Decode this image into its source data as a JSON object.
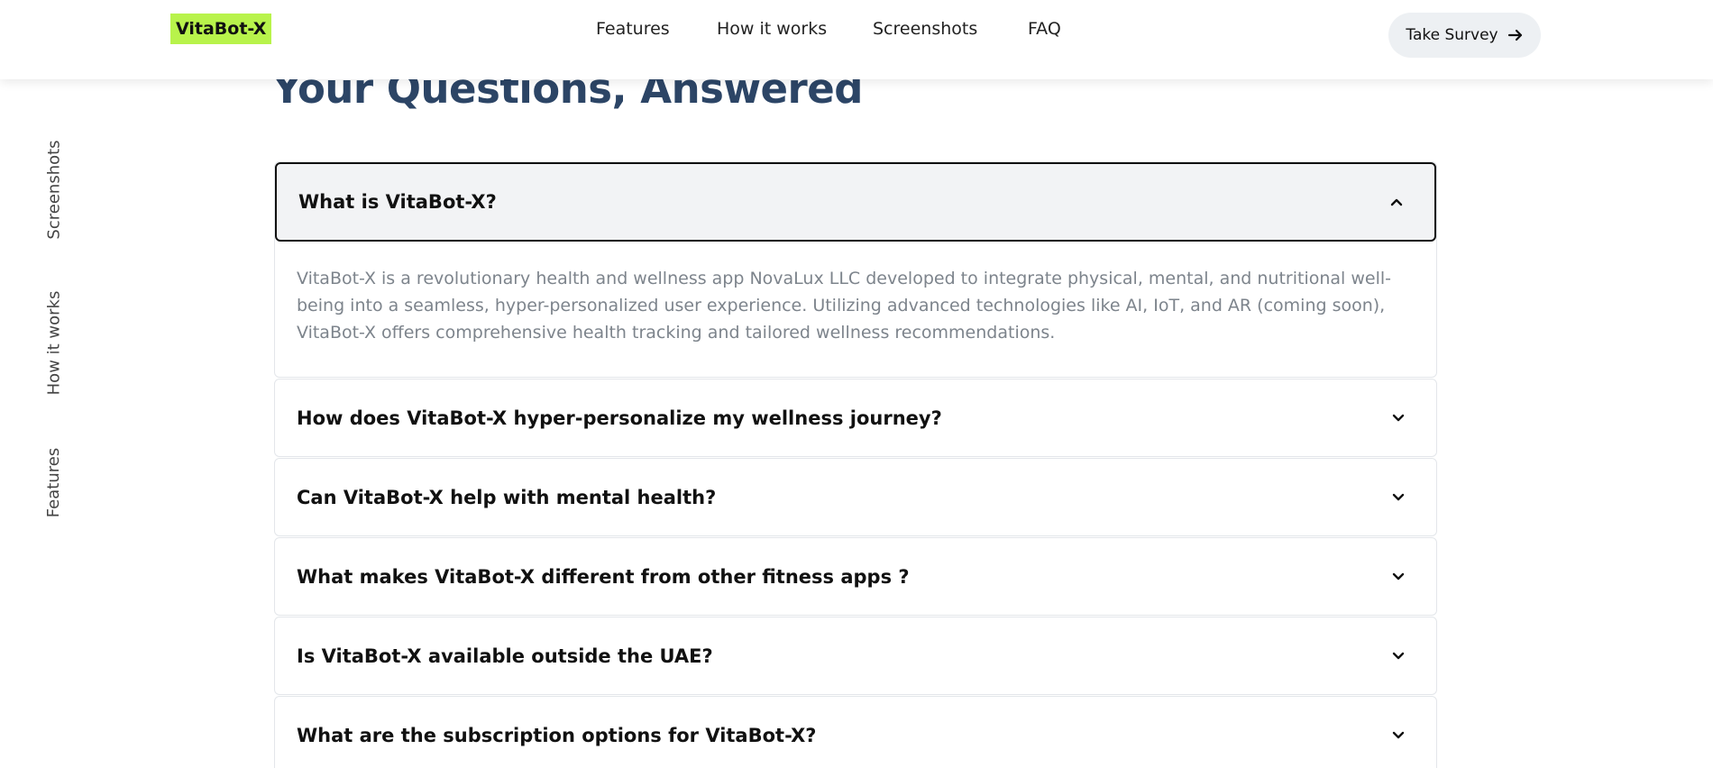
{
  "header": {
    "logo": "VitaBot-X",
    "nav": [
      "Features",
      "How it works",
      "Screenshots",
      "FAQ"
    ],
    "cta_label": "Take Survey",
    "cta_icon": "arrow-right-icon"
  },
  "side_nav": [
    "Screenshots",
    "How it works",
    "Features"
  ],
  "faq": {
    "title": "Your Questions, Answered",
    "items": [
      {
        "question": "What is VitaBot-X?",
        "expanded": true,
        "answer": "VitaBot-X is a revolutionary health and wellness app NovaLux LLC developed to integrate physical, mental, and nutritional well-being into a seamless, hyper-personalized user experience. Utilizing advanced technologies like AI, IoT, and AR (coming soon), VitaBot-X offers comprehensive health tracking and tailored wellness recommendations."
      },
      {
        "question": "How does VitaBot-X hyper-personalize my wellness journey?",
        "expanded": false
      },
      {
        "question": "Can VitaBot-X help with mental health?",
        "expanded": false
      },
      {
        "question": "What makes VitaBot-X different from other fitness apps ?",
        "expanded": false
      },
      {
        "question": "Is VitaBot-X available outside the UAE?",
        "expanded": false
      },
      {
        "question": "What are the subscription options for VitaBot-X?",
        "expanded": false
      }
    ]
  },
  "colors": {
    "logo_bg": "#b8f34b",
    "title": "#2c4566",
    "answer_text": "#7d848c",
    "open_question_bg": "#f2f3f5",
    "cta_bg": "#edf0f3"
  }
}
